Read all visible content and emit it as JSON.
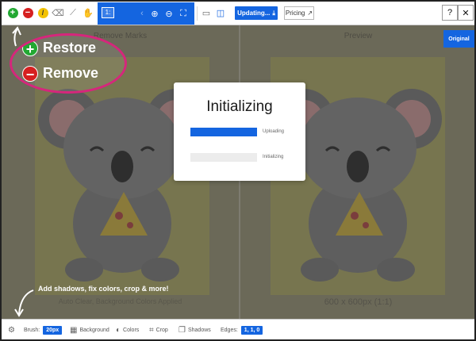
{
  "topbar": {
    "icons": [
      "restore-plus-icon",
      "remove-minus-icon",
      "magic-wand-icon",
      "eraser-icon",
      "lasso-icon",
      "hand-pan-icon",
      "zoom-in-icon",
      "zoom-out-icon",
      "fit-screen-icon",
      "single-view-icon",
      "split-view-icon",
      "download-icon",
      "external-link-icon"
    ],
    "zoom_select": "1:",
    "updating_label": "Updating...",
    "pricing_label": "Pricing",
    "help_label": "?",
    "close_label": "✕"
  },
  "panes": {
    "left_title": "Remove Marks",
    "right_title": "Preview",
    "left_footnote": "Auto Clear, Background Colors Applied",
    "right_footnote": "600 x 600px (1:1)",
    "original_label": "Original"
  },
  "modal": {
    "title": "Initializing",
    "bars": [
      {
        "label": "Uploading",
        "progress": 1.0
      },
      {
        "label": "Initializing",
        "progress": 0.0
      }
    ]
  },
  "annotation": {
    "restore_label": "Restore",
    "remove_label": "Remove",
    "bottom_label": "Add shadows, fix colors, crop & more!",
    "colors": {
      "pink": "#d6267c",
      "green": "#22a832",
      "red": "#d62020"
    }
  },
  "bottombar": {
    "brush_label": "Brush:",
    "brush_value": "20px",
    "background_label": "Background",
    "colors_label": "Colors",
    "crop_label": "Crop",
    "shadows_label": "Shadows",
    "edges_label": "Edges:",
    "edges_value": "1, 1, 0"
  },
  "theme": {
    "accent": "#1465e0"
  }
}
